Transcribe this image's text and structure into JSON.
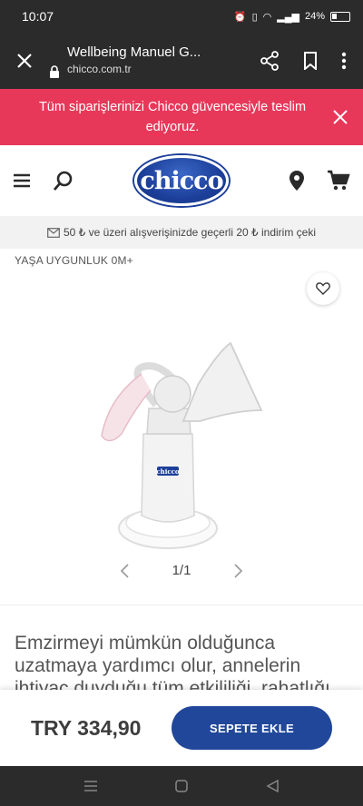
{
  "status": {
    "time": "10:07",
    "battery": "24%"
  },
  "browser": {
    "title": "Wellbeing Manuel G...",
    "url": "chicco.com.tr"
  },
  "promo": {
    "text": "Tüm siparişlerinizi Chicco güvencesiyle teslim ediyoruz."
  },
  "header": {
    "logo_text": "chicco"
  },
  "discount": {
    "text": "50 ₺ ve üzeri alışverişinizde geçerli 20 ₺ indirim çeki"
  },
  "product": {
    "age": "YAŞA UYGUNLUK 0M+",
    "pager": "1/1",
    "bottle_label": "chicco",
    "description": "Emzirmeyi mümkün olduğunca uzatmaya yardımcı olur, annelerin ihtiyaç duyduğu tüm etkililiği, rahatlığı"
  },
  "buy": {
    "price": "TRY 334,90",
    "button": "SEPETE EKLE"
  },
  "colors": {
    "accent": "#21479a",
    "promo": "#e8385a"
  }
}
